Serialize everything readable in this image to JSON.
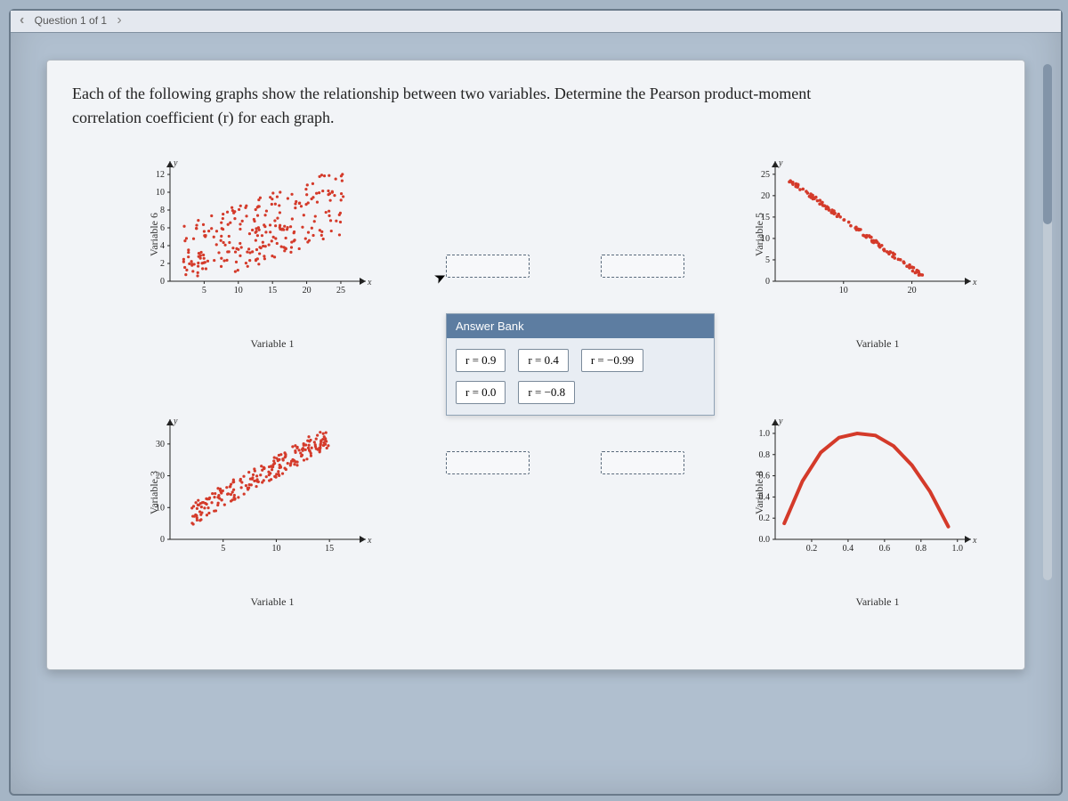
{
  "nav": {
    "title": "Question 1 of 1"
  },
  "question": {
    "text_line1": "Each of the following graphs show the relationship between two variables. Determine the Pearson product-moment",
    "text_line2": "correlation coefficient (r) for each graph.",
    "r_symbol": "r"
  },
  "answer_bank": {
    "title": "Answer Bank",
    "options": [
      "r = 0.9",
      "r = 0.4",
      "r = −0.99",
      "r = 0.0",
      "r = −0.8"
    ]
  },
  "charts": {
    "top_left": {
      "ylabel": "Variable 6",
      "xlabel": "Variable 1",
      "y_ticks": [
        0,
        2,
        4,
        6,
        8,
        10,
        12
      ],
      "x_ticks": [
        5,
        10,
        15,
        20,
        25
      ],
      "xlim": [
        0,
        28
      ],
      "ylim": [
        0,
        12.5
      ]
    },
    "top_right": {
      "ylabel": "Variable 5",
      "xlabel": "Variable 1",
      "y_ticks": [
        0,
        5,
        10,
        15,
        20,
        25
      ],
      "x_ticks": [
        10,
        20
      ],
      "xlim": [
        0,
        28
      ],
      "ylim": [
        0,
        26
      ]
    },
    "bottom_left": {
      "ylabel": "Variable 3",
      "xlabel": "Variable 1",
      "y_ticks": [
        0,
        10,
        20,
        30
      ],
      "x_ticks": [
        5,
        10,
        15
      ],
      "xlim": [
        0,
        18
      ],
      "ylim": [
        0,
        35
      ]
    },
    "bottom_right": {
      "ylabel": "Variable 8",
      "xlabel": "Variable 1",
      "y_ticks": [
        0,
        0.2,
        0.4,
        0.6,
        0.8,
        1.0
      ],
      "x_ticks": [
        0.2,
        0.4,
        0.6,
        0.8,
        1.0
      ],
      "xlim": [
        0,
        1.05
      ],
      "ylim": [
        0,
        1.05
      ]
    }
  },
  "chart_data": [
    {
      "type": "scatter",
      "title": "",
      "xlabel": "Variable 1",
      "ylabel": "Variable 6",
      "xlim": [
        0,
        28
      ],
      "ylim": [
        0,
        12.5
      ],
      "series": [
        {
          "name": "points",
          "approx_r": 0.4,
          "note": "diffuse positive cloud",
          "cluster_bounds": {
            "x": [
              2,
              26
            ],
            "y": [
              2,
              12
            ]
          }
        }
      ]
    },
    {
      "type": "scatter",
      "title": "",
      "xlabel": "Variable 1",
      "ylabel": "Variable 5",
      "xlim": [
        0,
        28
      ],
      "ylim": [
        0,
        26
      ],
      "series": [
        {
          "name": "points",
          "approx_r": -0.99,
          "note": "tight descending line",
          "line_segment": {
            "x": [
              2,
              22
            ],
            "y": [
              25,
              2
            ]
          }
        }
      ]
    },
    {
      "type": "scatter",
      "title": "",
      "xlabel": "Variable 1",
      "ylabel": "Variable 3",
      "xlim": [
        0,
        18
      ],
      "ylim": [
        0,
        35
      ],
      "series": [
        {
          "name": "points",
          "approx_r": 0.9,
          "note": "tight ascending cloud",
          "cluster_bounds": {
            "x": [
              2,
              15
            ],
            "y": [
              8,
              32
            ]
          }
        }
      ]
    },
    {
      "type": "line",
      "title": "",
      "xlabel": "Variable 1",
      "ylabel": "Variable 8",
      "xlim": [
        0,
        1.05
      ],
      "ylim": [
        0,
        1.05
      ],
      "series": [
        {
          "name": "curve",
          "approx_r": 0.0,
          "note": "inverted-U parabola",
          "x": [
            0.05,
            0.15,
            0.25,
            0.35,
            0.45,
            0.55,
            0.65,
            0.75,
            0.85,
            0.95
          ],
          "y": [
            0.15,
            0.55,
            0.82,
            0.96,
            1.0,
            0.98,
            0.88,
            0.7,
            0.45,
            0.12
          ]
        }
      ]
    }
  ]
}
